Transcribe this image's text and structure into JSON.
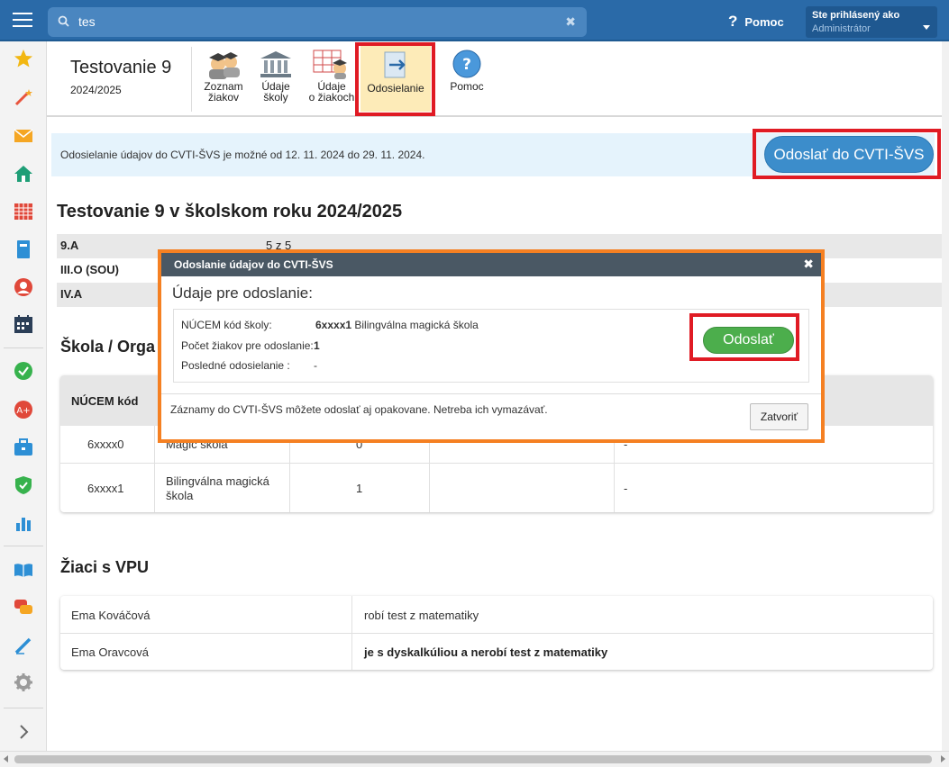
{
  "topbar": {
    "search_value": "tes",
    "help_label": "Pomoc",
    "user_line1": "Ste prihlásený ako",
    "user_line2": "Administrátor"
  },
  "module": {
    "title": "Testovanie 9",
    "year": "2024/2025",
    "tools": [
      {
        "line1": "Zoznam",
        "line2": "žiakov"
      },
      {
        "line1": "Údaje",
        "line2": "školy"
      },
      {
        "line1": "Údaje",
        "line2": "o žiakoch"
      },
      {
        "line1": "Odosielanie",
        "line2": ""
      },
      {
        "line1": "Pomoc",
        "line2": ""
      }
    ]
  },
  "notice": {
    "text": "Odosielanie údajov do CVTI-ŠVS je možné od 12. 11. 2024 do 29. 11. 2024.",
    "button": "Odoslať do CVTI-ŠVS"
  },
  "main": {
    "heading": "Testovanie 9 v školskom roku 2024/2025",
    "classes": [
      {
        "name": "9.A",
        "value": "5 z 5"
      },
      {
        "name": "III.O (SOU)",
        "value": ""
      },
      {
        "name": "IV.A",
        "value": ""
      }
    ],
    "school_heading": "Škola / Orga",
    "school_table": {
      "header_first": "NÚCEM kód",
      "rows": [
        {
          "code": "6xxxx0",
          "name": "Magic škola",
          "count": "0",
          "c4": "",
          "c5": "-"
        },
        {
          "code": "6xxxx1",
          "name": "Bilingválna magická škola",
          "count": "1",
          "c4": "",
          "c5": "-"
        }
      ]
    },
    "vpu_heading": "Žiaci s VPU",
    "vpu_rows": [
      {
        "name": "Ema Kováčová",
        "note": "robí test z matematiky"
      },
      {
        "name": "Ema Oravcová",
        "note": "je s dyskalkúliou a nerobí test z matematiky"
      }
    ]
  },
  "modal": {
    "title": "Odoslanie údajov do CVTI-ŠVS",
    "subtitle": "Údaje pre odoslanie:",
    "labels": [
      "NÚCEM kód školy:",
      "Počet žiakov pre odoslanie:",
      "Posledné odosielanie :"
    ],
    "school_code": "6xxxx1",
    "school_name": "Bilingválna magická škola",
    "count": "1",
    "last_send": "-",
    "send_button": "Odoslať",
    "footer_note": "Záznamy do CVTI-ŠVS môžete odoslať aj opakovane. Netreba ich vymazávať.",
    "close_button": "Zatvoriť"
  }
}
